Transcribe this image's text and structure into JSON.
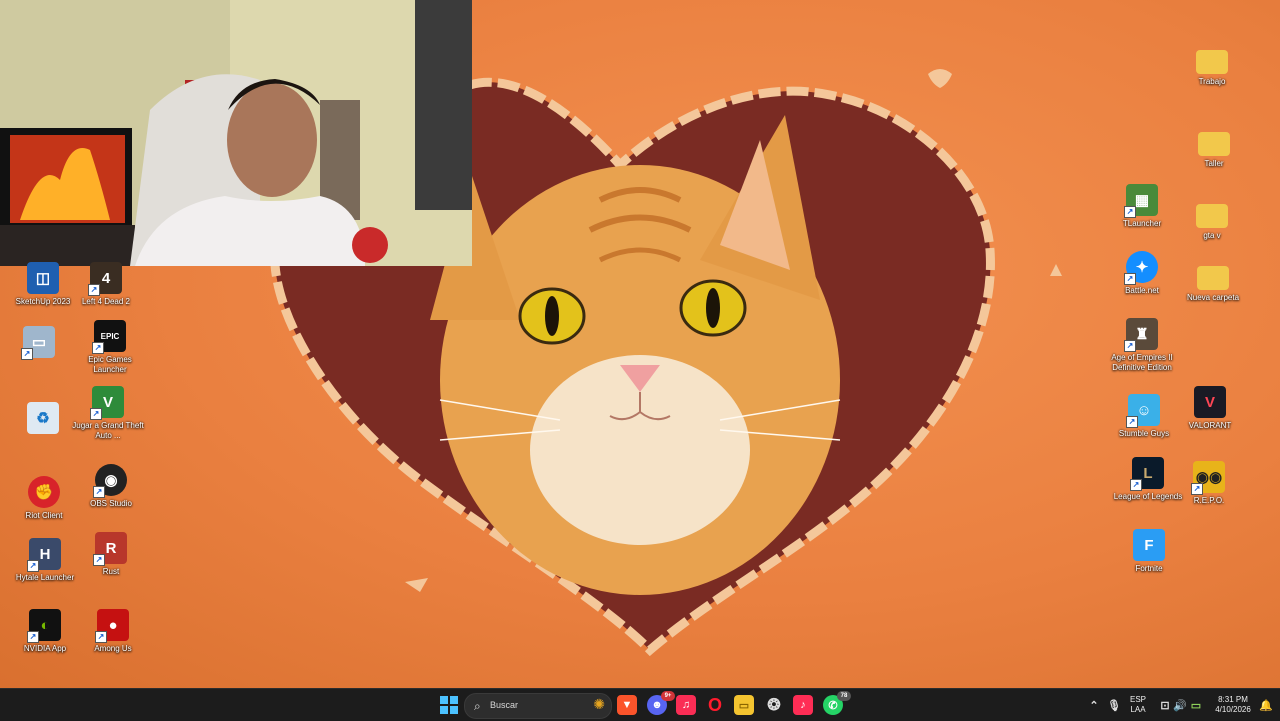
{
  "desktop": {
    "left_icons": [
      {
        "label": "SketchUp 2023",
        "icon": "sketchup-icon"
      },
      {
        "label": "Left 4 Dead 2",
        "icon": "left4dead2-icon"
      },
      {
        "label": "",
        "icon": "shortcut-monitor-icon"
      },
      {
        "label": "Epic Games Launcher",
        "icon": "epic-games-icon"
      },
      {
        "label": "",
        "icon": "recycle-bin-icon"
      },
      {
        "label": "Jugar a Grand Theft Auto ...",
        "icon": "gta-v-icon"
      },
      {
        "label": "Riot Client",
        "icon": "riot-client-icon"
      },
      {
        "label": "OBS Studio",
        "icon": "obs-studio-icon"
      },
      {
        "label": "Hytale Launcher",
        "icon": "hytale-icon"
      },
      {
        "label": "Rust",
        "icon": "rust-icon"
      },
      {
        "label": "NVIDIA App",
        "icon": "nvidia-icon"
      },
      {
        "label": "Among Us",
        "icon": "among-us-icon"
      }
    ],
    "right_icons": [
      {
        "label": "Trabajo",
        "icon": "folder-icon"
      },
      {
        "label": "Taller",
        "icon": "folder-icon"
      },
      {
        "label": "TLauncher",
        "icon": "tlauncher-icon"
      },
      {
        "label": "gta v",
        "icon": "folder-icon"
      },
      {
        "label": "Battle.net",
        "icon": "battlenet-icon"
      },
      {
        "label": "Nueva carpeta",
        "icon": "folder-icon"
      },
      {
        "label": "Age of Empires II Definitive Edition",
        "icon": "age-of-empires-icon"
      },
      {
        "label": "Stumble Guys",
        "icon": "stumble-guys-icon"
      },
      {
        "label": "VALORANT",
        "icon": "valorant-icon"
      },
      {
        "label": "League of Legends",
        "icon": "league-of-legends-icon"
      },
      {
        "label": "R.E.P.O.",
        "icon": "repo-icon"
      },
      {
        "label": "Fortnite",
        "icon": "fortnite-icon"
      }
    ]
  },
  "taskbar": {
    "search_placeholder": "Buscar",
    "pinned": [
      "windows-start-icon",
      "brave-icon",
      "discord-icon",
      "apple-music-icon",
      "opera-icon",
      "file-explorer-icon",
      "chatgpt-icon",
      "tiktok-icon",
      "whatsapp-icon"
    ],
    "discord_badge": "9+",
    "whatsapp_badge": "78",
    "tray": {
      "lang_top": "ESP",
      "lang_bottom": "LAA",
      "time": "8:31 PM",
      "date": "4/10/2026"
    }
  },
  "colors": {
    "wallpaper": "#e8823a",
    "taskbar": "#1c1c1c",
    "cat_fur": "#e8a24f",
    "cat_eyes": "#e3c21b"
  }
}
